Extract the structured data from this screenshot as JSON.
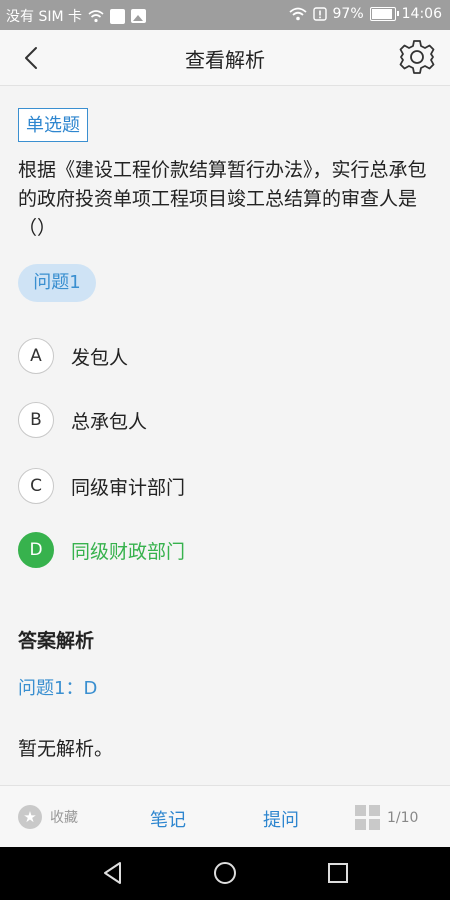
{
  "status_bar": {
    "carrier": "没有 SIM 卡",
    "battery": "97%",
    "battery_level": 0.97,
    "time": "14:06"
  },
  "header": {
    "title": "查看解析",
    "back_icon": "chevron-left-icon",
    "settings_icon": "gear-icon"
  },
  "question": {
    "type_tag": "单选题",
    "text": "根据《建设工程价款结算暂行办法》，实行总承包的政府投资单项工程项目竣工总结算的审查人是（）",
    "label": "问题1",
    "options": [
      {
        "letter": "A",
        "text": "发包人",
        "correct": false
      },
      {
        "letter": "B",
        "text": "总承包人",
        "correct": false
      },
      {
        "letter": "C",
        "text": "同级审计部门",
        "correct": false
      },
      {
        "letter": "D",
        "text": "同级财政部门",
        "correct": true
      }
    ]
  },
  "analysis": {
    "title": "答案解析",
    "answer": "问题1：D",
    "text": "暂无解析。"
  },
  "toolbar": {
    "favorite": "收藏",
    "notes": "笔记",
    "ask": "提问",
    "page": "1/10"
  },
  "colors": {
    "accent": "#2e86cf",
    "correct": "#37b24d",
    "status_bar": "#9e9e9e"
  }
}
